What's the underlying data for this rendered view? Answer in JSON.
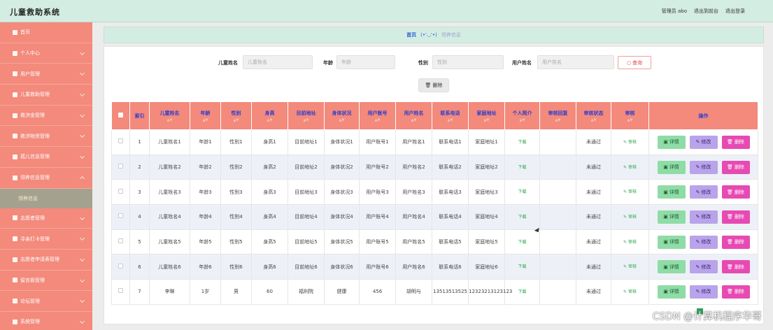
{
  "app": {
    "title": "儿童救助系统",
    "admin": "管理员 abo",
    "back_front": "退出到前台",
    "logout": "退出登录"
  },
  "sidebar": {
    "items": [
      {
        "label": "首页",
        "icon": "home-icon"
      },
      {
        "label": "个人中心",
        "icon": "user-icon"
      },
      {
        "label": "用户管理",
        "icon": "clock-icon"
      },
      {
        "label": "儿童救助管理",
        "icon": "list-icon"
      },
      {
        "label": "救济金管理",
        "icon": "user-icon"
      },
      {
        "label": "救济物资管理",
        "icon": "box-icon"
      },
      {
        "label": "孤儿信息管理",
        "icon": "doc-icon"
      },
      {
        "label": "领养信息管理",
        "icon": "form-icon"
      },
      {
        "label": "志愿者管理",
        "icon": "list-icon"
      },
      {
        "label": "寻亲打卡管理",
        "icon": "grid-icon"
      },
      {
        "label": "志愿者申请表管理",
        "icon": "doc-icon"
      },
      {
        "label": "留言板管理",
        "icon": "chart-icon"
      },
      {
        "label": "论坛管理",
        "icon": "chat-icon"
      },
      {
        "label": "系统管理",
        "icon": "gear-icon"
      }
    ],
    "open_index": 7,
    "sub_item": "领养信息"
  },
  "breadcrumb": {
    "home": "首页",
    "sep": "(•'◡'•)",
    "current": "领养信息"
  },
  "filters": {
    "child_name_label": "儿童姓名",
    "child_name_placeholder": "儿童姓名",
    "age_label": "年龄",
    "age_placeholder": "年龄",
    "gender_label": "性别",
    "gender_placeholder": "性别",
    "user_name_label": "用户姓名",
    "user_name_placeholder": "用户姓名",
    "search_label": "查询",
    "bulk_delete_label": "删除"
  },
  "table": {
    "headers": [
      "索引",
      "儿童姓名",
      "年龄",
      "性别",
      "身高",
      "目前地址",
      "身体状况",
      "用户账号",
      "用户姓名",
      "联系电话",
      "家庭地址",
      "个人简介",
      "审核回复",
      "审核状态",
      "审核",
      "操作"
    ],
    "rows": [
      {
        "idx": "1",
        "child": "儿童姓名1",
        "age": "年龄1",
        "gender": "性别1",
        "height": "身高1",
        "addr": "目前地址1",
        "health": "身体状况1",
        "account": "用户账号1",
        "user": "用户姓名1",
        "phone": "联系电话1",
        "home": "家庭地址1",
        "intro": "下载",
        "reply": "",
        "status": "未通过",
        "review": "审核"
      },
      {
        "idx": "2",
        "child": "儿童姓名2",
        "age": "年龄2",
        "gender": "性别2",
        "height": "身高2",
        "addr": "目前地址2",
        "health": "身体状况2",
        "account": "用户账号2",
        "user": "用户姓名2",
        "phone": "联系电话2",
        "home": "家庭地址2",
        "intro": "下载",
        "reply": "",
        "status": "未通过",
        "review": "审核"
      },
      {
        "idx": "3",
        "child": "儿童姓名3",
        "age": "年龄3",
        "gender": "性别3",
        "height": "身高3",
        "addr": "目前地址3",
        "health": "身体状况3",
        "account": "用户账号3",
        "user": "用户姓名3",
        "phone": "联系电话3",
        "home": "家庭地址3",
        "intro": "下载",
        "reply": "",
        "status": "未通过",
        "review": "审核"
      },
      {
        "idx": "4",
        "child": "儿童姓名4",
        "age": "年龄4",
        "gender": "性别4",
        "height": "身高4",
        "addr": "目前地址4",
        "health": "身体状况4",
        "account": "用户账号4",
        "user": "用户姓名4",
        "phone": "联系电话4",
        "home": "家庭地址4",
        "intro": "下载",
        "reply": "",
        "status": "未通过",
        "review": "审核"
      },
      {
        "idx": "5",
        "child": "儿童姓名5",
        "age": "年龄5",
        "gender": "性别5",
        "height": "身高5",
        "addr": "目前地址5",
        "health": "身体状况5",
        "account": "用户账号5",
        "user": "用户姓名5",
        "phone": "联系电话5",
        "home": "家庭地址5",
        "intro": "下载",
        "reply": "",
        "status": "未通过",
        "review": "审核"
      },
      {
        "idx": "6",
        "child": "儿童姓名6",
        "age": "年龄6",
        "gender": "性别6",
        "height": "身高6",
        "addr": "目前地址6",
        "health": "身体状况6",
        "account": "用户账号6",
        "user": "用户姓名6",
        "phone": "联系电话6",
        "home": "家庭地址6",
        "intro": "下载",
        "reply": "",
        "status": "未通过",
        "review": "审核"
      },
      {
        "idx": "7",
        "child": "李琳",
        "age": "1岁",
        "gender": "男",
        "height": "60",
        "addr": "福利院",
        "health": "健康",
        "account": "456",
        "user": "胡明与",
        "phone": "13513513525",
        "home": "12323213123123",
        "intro": "下载",
        "reply": "",
        "status": "未通过",
        "review": "审核"
      }
    ],
    "actions": {
      "detail": "详情",
      "edit": "修改",
      "delete": "删除"
    }
  },
  "watermark": "CSDN @计算机程序华哥",
  "colors": {
    "sidebar": "#f38a7c",
    "header_bg": "#d4ede2",
    "table_header": "#f38a7c",
    "detail_btn": "#8fdca6",
    "edit_btn": "#b9a3ea",
    "delete_btn": "#e74ab2"
  }
}
